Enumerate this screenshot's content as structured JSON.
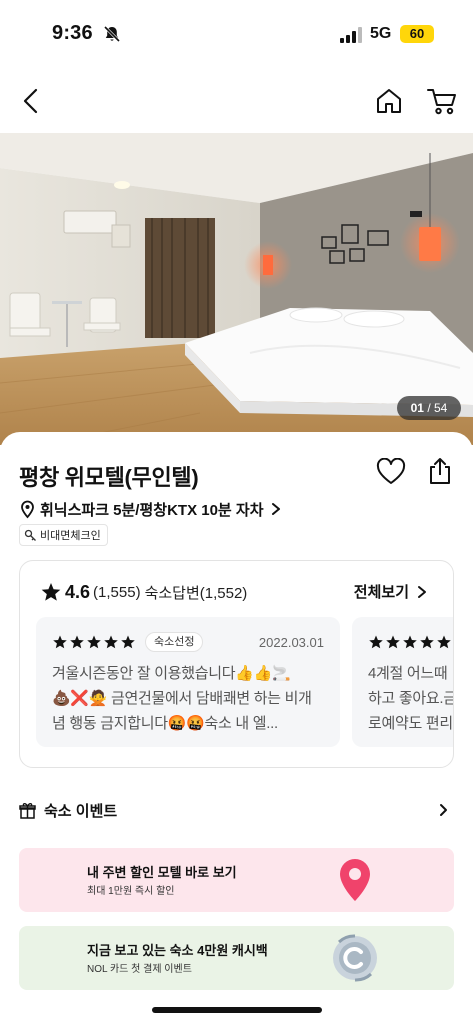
{
  "status_bar": {
    "time": "9:36",
    "network": "5G",
    "battery": "60",
    "battery_color": "#ffd60a"
  },
  "nav": {
    "back_icon": "chevron-left-icon",
    "home_icon": "home-icon",
    "cart_icon": "cart-icon"
  },
  "gallery": {
    "current": "01",
    "separator": " / ",
    "total": "54"
  },
  "hotel": {
    "name": "평창 위모텔(무인텔)",
    "location": "휘닉스파크 5분/평창KTX 10분 자차",
    "tag": "비대면체크인"
  },
  "reviews": {
    "rating": "4.6",
    "rating_count": "(1,555)",
    "reply_label": "숙소답변(1,552)",
    "see_all": "전체보기",
    "star_color": "#111111",
    "items": [
      {
        "badge": "숙소선정",
        "date": "2022.03.01",
        "text": "겨울시즌동안 잘 이용했습니다👍👍🚬\n💩❌🙅 금연건물에서 담배쾌변 하는 비개념 행동 금지합니다🤬🤬숙소 내 엘..."
      },
      {
        "text": "4계절 어느때\n하고 좋아요.금\n로예약도 편리"
      }
    ]
  },
  "event": {
    "title": "숙소 이벤트"
  },
  "banners": [
    {
      "title": "내 주변 할인 모텔 바로 보기",
      "subtitle": "최대 1만원 즉시 할인",
      "color": "#fde6ec"
    },
    {
      "title": "지금 보고 있는 숙소 4만원 캐시백",
      "subtitle": "NOL 카드 첫 결제 이벤트",
      "color": "#eaf3e6"
    }
  ]
}
